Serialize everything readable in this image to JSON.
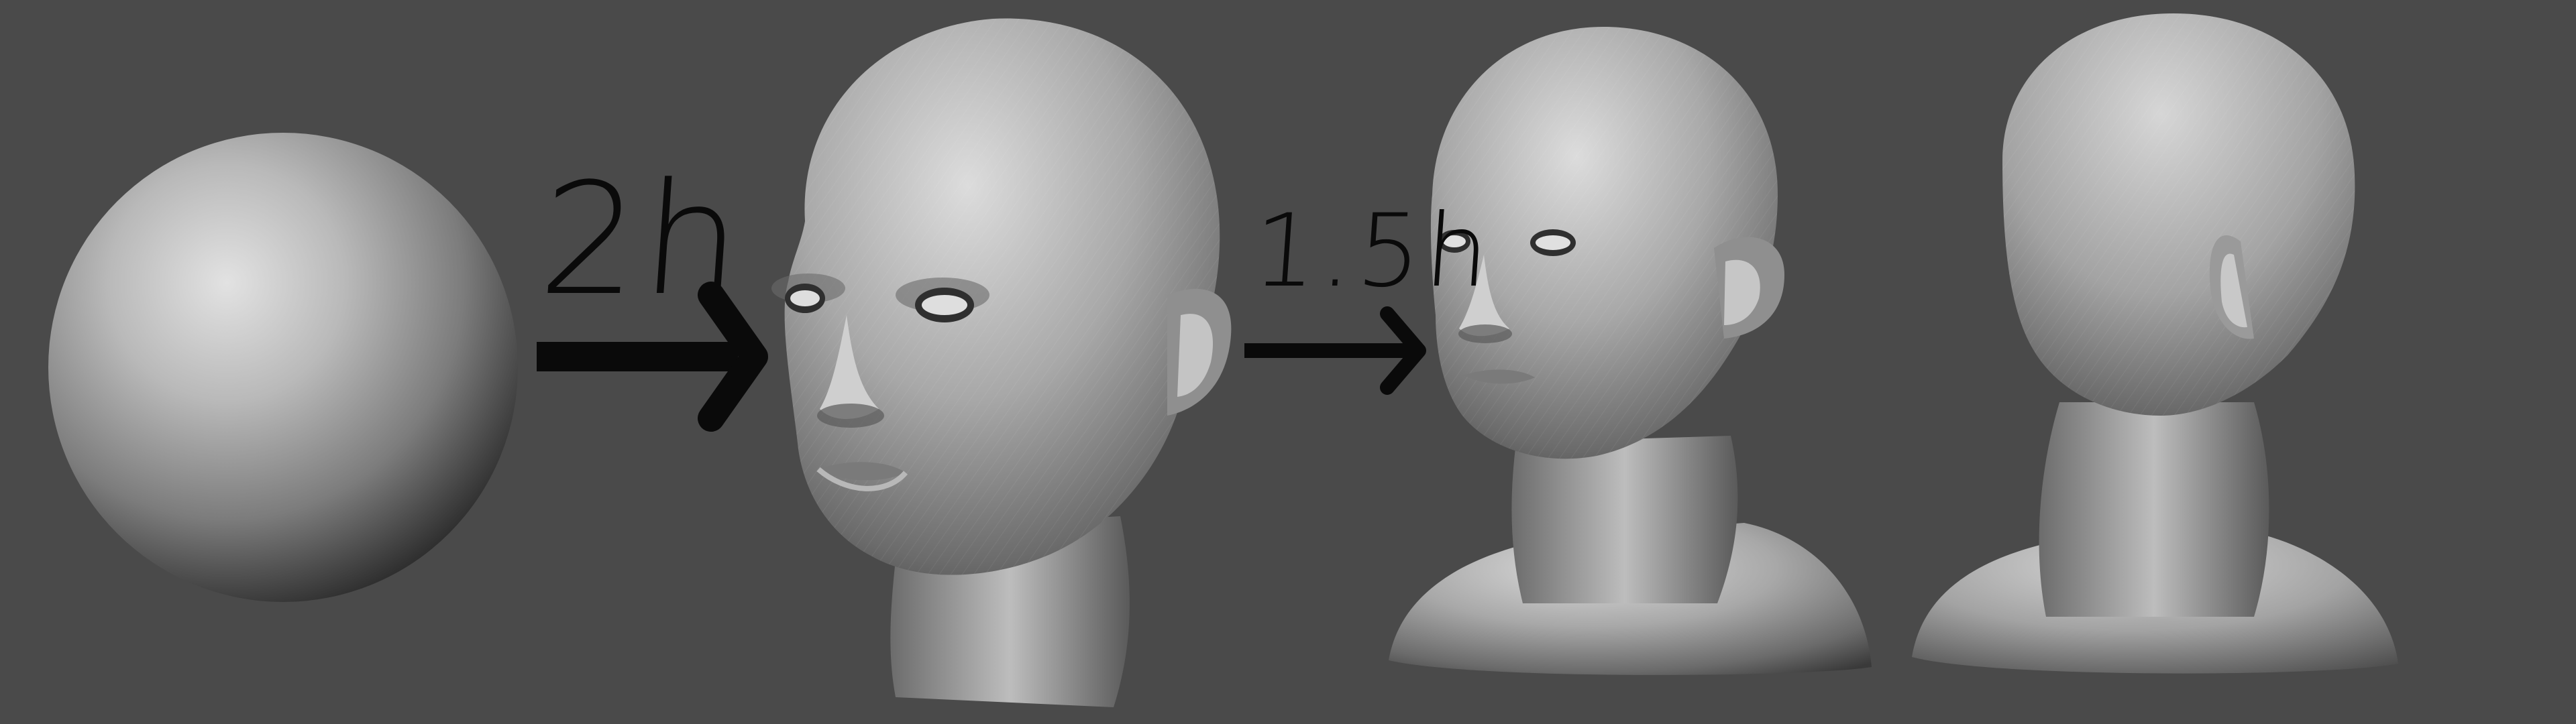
{
  "labels": {
    "step1_time": "2h",
    "step2_time": "1.5h"
  },
  "colors": {
    "background": "#4a4a4a",
    "clay_light": "#d9d9d9",
    "clay_mid": "#9a9a9a",
    "clay_dark": "#2e2e2e",
    "ink": "#0a0a0a"
  },
  "icons": {
    "arrow1": "arrow-right-icon",
    "arrow2": "arrow-right-icon"
  }
}
